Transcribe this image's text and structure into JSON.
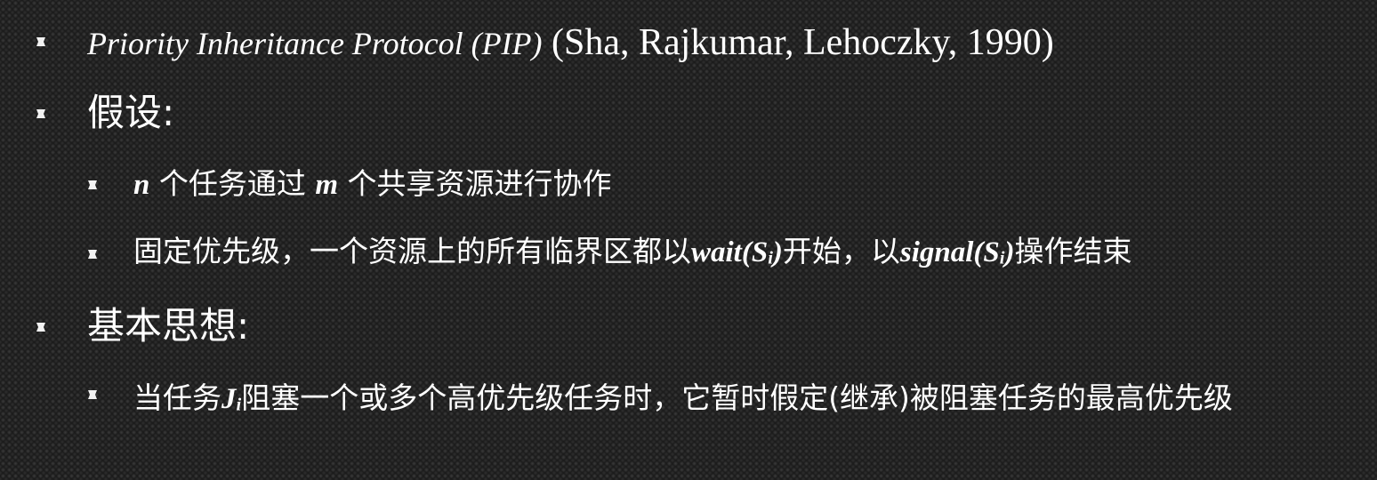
{
  "bullets": [
    {
      "level": 1,
      "title_italic": "Priority Inheritance Protocol (PIP)",
      "citation": " (Sha, Rajkumar, Lehoczky, 1990)"
    },
    {
      "level": 1,
      "text": "假设:"
    },
    {
      "level": 2,
      "var_n": "n",
      "text_a": " 个任务通过 ",
      "var_m": "m",
      "text_b": " 个共享资源进行协作"
    },
    {
      "level": 2,
      "text_a": "固定优先级，一个资源上的所有临界区都以",
      "wait_fn": "wait(S",
      "wait_sub": "i",
      "wait_close": ")",
      "text_b": "开始，以",
      "signal_fn": "signal(S",
      "signal_sub": "i",
      "signal_close": ")",
      "text_c": "操作结束"
    },
    {
      "level": 1,
      "text": "基本思想:"
    },
    {
      "level": 2,
      "text_a": "当任务",
      "job": "J",
      "job_sub": "i",
      "text_b": "阻塞一个或多个高优先级任务时，它暂时假定(继承)被阻塞任务的最高优先级"
    }
  ],
  "colors": {
    "text": "#ffffff",
    "background": "#1c1c1c",
    "bullet": "#f2f2f2"
  },
  "icons": {
    "bullet": "square-bullet-icon"
  }
}
